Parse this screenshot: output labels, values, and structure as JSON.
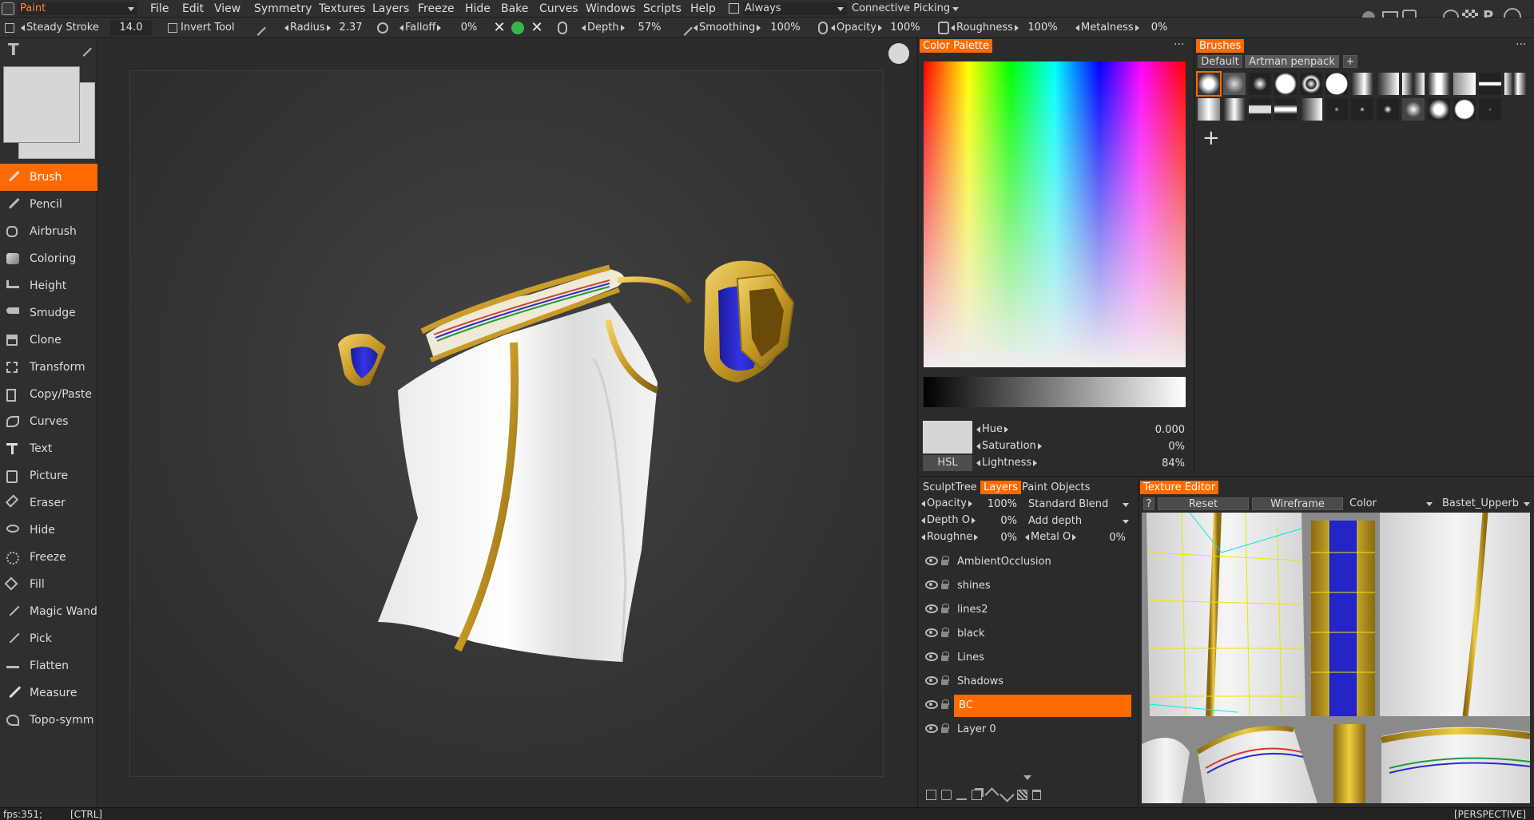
{
  "menubar": {
    "mode_select": "Paint",
    "items": [
      "File",
      "Edit",
      "View",
      "Symmetry",
      "Textures",
      "Layers",
      "Freeze",
      "Hide",
      "Bake",
      "Curves",
      "Windows",
      "Scripts",
      "Help"
    ],
    "always_label": "Always",
    "connective_picking": "Connective Picking"
  },
  "options": {
    "steady_stroke_label": "Steady Stroke",
    "steady_stroke_value": "14.0",
    "invert_tool_label": "Invert Tool",
    "radius_label": "Radius",
    "radius_value": "2.37",
    "falloff_label": "Falloff",
    "falloff_value": "0%",
    "depth_label": "Depth",
    "depth_value": "57%",
    "smoothing_label": "Smoothing",
    "smoothing_value": "100%",
    "opacity_label": "Opacity",
    "opacity_value": "100%",
    "roughness_label": "Roughness",
    "roughness_value": "100%",
    "metalness_label": "Metalness",
    "metalness_value": "0%"
  },
  "tools": [
    {
      "label": "Brush",
      "icon": "brush-icon",
      "selected": true
    },
    {
      "label": "Pencil",
      "icon": "pencil-icon"
    },
    {
      "label": "Airbrush",
      "icon": "airbrush-icon"
    },
    {
      "label": "Coloring",
      "icon": "coloring-icon"
    },
    {
      "label": "Height",
      "icon": "height-icon"
    },
    {
      "label": "Smudge",
      "icon": "smudge-icon"
    },
    {
      "label": "Clone",
      "icon": "clone-icon"
    },
    {
      "label": "Transform",
      "icon": "transform-icon"
    },
    {
      "label": "Copy/Paste",
      "icon": "copy-paste-icon"
    },
    {
      "label": "Curves",
      "icon": "curves-icon"
    },
    {
      "label": "Text",
      "icon": "text-icon"
    },
    {
      "label": "Picture",
      "icon": "picture-icon"
    },
    {
      "label": "Eraser",
      "icon": "eraser-icon"
    },
    {
      "label": "Hide",
      "icon": "hide-icon"
    },
    {
      "label": "Freeze",
      "icon": "freeze-icon"
    },
    {
      "label": "Fill",
      "icon": "fill-icon"
    },
    {
      "label": "Magic Wand",
      "icon": "magic-wand-icon"
    },
    {
      "label": "Pick",
      "icon": "pick-icon"
    },
    {
      "label": "Flatten",
      "icon": "flatten-icon"
    },
    {
      "label": "Measure",
      "icon": "measure-icon"
    },
    {
      "label": "Topo-symm",
      "icon": "topo-symm-icon"
    }
  ],
  "color_palette": {
    "tab": "Color Palette",
    "mode": "HSL",
    "hue_label": "Hue",
    "hue_value": "0.000",
    "saturation_label": "Saturation",
    "saturation_value": "0%",
    "lightness_label": "Lightness",
    "lightness_value": "84%",
    "current_color": "#d6d6d6"
  },
  "brushes": {
    "tab": "Brushes",
    "packs": [
      "Default",
      "Artman penpack"
    ],
    "active_pack": "Artman penpack",
    "add_label": "+"
  },
  "layers_panel": {
    "tabs": [
      "SculptTree",
      "Layers",
      "Paint Objects"
    ],
    "active_tab": "Layers",
    "opacity_label": "Opacity",
    "opacity_value": "100%",
    "blend_mode": "Standard Blend",
    "depth_label": "Depth O",
    "depth_value": "0%",
    "depth_mode": "Add depth",
    "rough_label": "Roughne",
    "rough_value": "0%",
    "metal_label": "Metal O",
    "metal_value": "0%",
    "layers": [
      "AmbientOcclusion",
      "shines",
      "lines2",
      "black",
      "Lines",
      "Shadows",
      "BC",
      "Layer 0"
    ],
    "selected_layer": "BC"
  },
  "texture_editor": {
    "tab": "Texture Editor",
    "help": "?",
    "reset": "Reset",
    "wireframe": "Wireframe",
    "channel": "Color",
    "texture": "Bastet_Upperb"
  },
  "status": {
    "fps": "fps:351;",
    "modifier": "[CTRL]",
    "projection": "[PERSPECTIVE]"
  },
  "colors": {
    "accent": "#ff6a00",
    "gold": "#c8a028",
    "blue": "#2a2ad0"
  }
}
